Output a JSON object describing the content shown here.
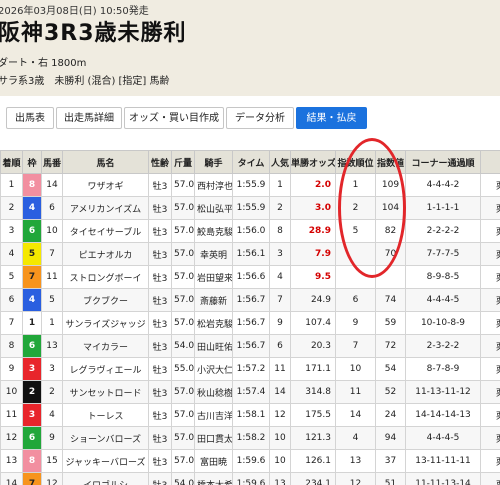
{
  "race": {
    "date": "2026年03月08日(日) 10:50発走",
    "title": "阪神3R3歳未勝利",
    "course": "ダート・右 1800m",
    "conditions": "サラ系3歳　未勝利 (混合) [指定] 馬齢"
  },
  "tabs": [
    {
      "label": "出馬表"
    },
    {
      "label": "出走馬詳細"
    },
    {
      "label": "オッズ・買い目作成"
    },
    {
      "label": "データ分析"
    },
    {
      "label": "結果・払戻"
    }
  ],
  "table": {
    "headers": [
      "着順",
      "枠",
      "馬番",
      "馬名",
      "性齢",
      "斤量",
      "騎手",
      "タイム",
      "人気",
      "単勝オッズ",
      "指数順位",
      "指数値",
      "コーナー通過順",
      ""
    ],
    "rows": [
      {
        "cells": [
          "1",
          "8",
          "14",
          "ワザオギ",
          "牡3",
          "57.0",
          "西村淳也",
          "1:55.9",
          "1",
          "2.0",
          "1",
          "109",
          "4-4-4-2",
          "栗"
        ]
      },
      {
        "cells": [
          "2",
          "4",
          "6",
          "アメリカンイズム",
          "牡3",
          "57.0",
          "松山弘平",
          "1:55.9",
          "2",
          "3.0",
          "2",
          "104",
          "1-1-1-1",
          "栗"
        ]
      },
      {
        "cells": [
          "3",
          "6",
          "10",
          "タイセイサーブル",
          "牡3",
          "57.0",
          "鮫島克駿",
          "1:56.0",
          "8",
          "28.9",
          "5",
          "82",
          "2-2-2-2",
          "栗"
        ]
      },
      {
        "cells": [
          "4",
          "5",
          "7",
          "ピエナオルカ",
          "牡3",
          "57.0",
          "幸英明",
          "1:56.1",
          "3",
          "7.9",
          "",
          "70",
          "7-7-7-5",
          "栗"
        ]
      },
      {
        "cells": [
          "5",
          "7",
          "11",
          "ストロングボーイ",
          "牡3",
          "57.0",
          "岩田望来",
          "1:56.6",
          "4",
          "9.5",
          "",
          "",
          "8-9-8-5",
          "栗"
        ]
      },
      {
        "cells": [
          "6",
          "4",
          "5",
          "ブクブクー",
          "牡3",
          "57.0",
          "斎藤新",
          "1:56.7",
          "7",
          "24.9",
          "6",
          "74",
          "4-4-4-5",
          "栗"
        ]
      },
      {
        "cells": [
          "7",
          "1",
          "1",
          "サンライズジャッジ",
          "牡3",
          "57.0",
          "松岩克駿",
          "1:56.7",
          "9",
          "107.4",
          "9",
          "59",
          "10-10-8-9",
          "栗"
        ]
      },
      {
        "cells": [
          "8",
          "6",
          "13",
          "マイカラー",
          "牡3",
          "54.0",
          "田山旺佑",
          "1:56.7",
          "6",
          "20.3",
          "7",
          "72",
          "2-3-2-2",
          "栗"
        ]
      },
      {
        "cells": [
          "9",
          "3",
          "3",
          "レグラヴィエール",
          "牡3",
          "55.0",
          "小沢大仁",
          "1:57.2",
          "11",
          "171.1",
          "10",
          "54",
          "8-7-8-9",
          "栗"
        ]
      },
      {
        "cells": [
          "10",
          "2",
          "2",
          "サンセットロード",
          "牡3",
          "57.0",
          "秋山稔樹",
          "1:57.4",
          "14",
          "314.8",
          "11",
          "52",
          "11-13-11-12",
          "栗"
        ]
      },
      {
        "cells": [
          "11",
          "3",
          "4",
          "トーレス",
          "牡3",
          "57.0",
          "古川吉洋",
          "1:58.1",
          "12",
          "175.5",
          "14",
          "24",
          "14-14-14-13",
          "栗"
        ]
      },
      {
        "cells": [
          "12",
          "6",
          "9",
          "ショーンバローズ",
          "牡3",
          "57.0",
          "田口貫太",
          "1:58.2",
          "10",
          "121.3",
          "4",
          "94",
          "4-4-4-5",
          "栗"
        ]
      },
      {
        "cells": [
          "13",
          "8",
          "15",
          "ジャッキーバローズ",
          "牡3",
          "57.0",
          "富田暁",
          "1:59.6",
          "10",
          "126.1",
          "13",
          "37",
          "13-11-11-11",
          "栗"
        ]
      },
      {
        "cells": [
          "14",
          "7",
          "12",
          "イロゴルシ",
          "牡3",
          "54.0",
          "橋本太希",
          "1:59.6",
          "13",
          "234.1",
          "12",
          "51",
          "11-11-13-14",
          "栗"
        ]
      }
    ]
  },
  "waku_colors": {
    "1": {
      "bg": "#ffffff",
      "fg": "#222222"
    },
    "2": {
      "bg": "#111111",
      "fg": "#ffffff"
    },
    "3": {
      "bg": "#e8252b",
      "fg": "#ffffff"
    },
    "4": {
      "bg": "#2a5fe0",
      "fg": "#ffffff"
    },
    "5": {
      "bg": "#f5e800",
      "fg": "#222222"
    },
    "6": {
      "bg": "#21a73a",
      "fg": "#ffffff"
    },
    "7": {
      "bg": "#f7941d",
      "fg": "#222222"
    },
    "8": {
      "bg": "#f28fa0",
      "fg": "#ffffff"
    }
  },
  "colors": {
    "accent": "#1b72de",
    "highlight_circle": "#e2262a",
    "odds_red": "#d40000",
    "header_bg": "#f0ece1"
  }
}
